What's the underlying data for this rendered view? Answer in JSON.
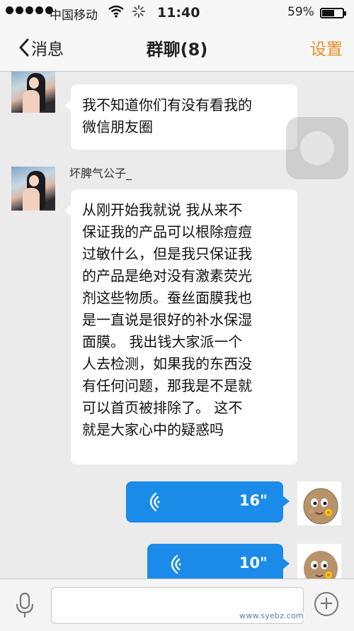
{
  "status_bar": {
    "carrier": "中国移动",
    "time": "11:40",
    "battery": "59%",
    "battery_level": 0.59
  },
  "nav": {
    "back_label": "消息",
    "title": "群聊(8)",
    "settings_label": "设置"
  },
  "messages": [
    {
      "sender": "",
      "text": "我不知道你们有没有看我的\n微信朋友圈"
    },
    {
      "sender": "坏脾气公子_",
      "text": "从刚开始我就说 我从来不\n保证我的产品可以根除痘痘\n过敏什么，但是我只保证我\n的产品是绝对没有激素荧光\n剂这些物质。蚕丝面膜我也\n是一直说是很好的补水保湿\n面膜。  我出钱大家派一个\n人去检测，如果我的东西没\n有任何问题，那我是不是就\n可以首页被排除了。 这不\n就是大家心中的疑惑吗"
    }
  ],
  "voice_messages": [
    {
      "duration": "16\""
    },
    {
      "duration": "10\""
    }
  ],
  "watermark": "www.syebz.com"
}
